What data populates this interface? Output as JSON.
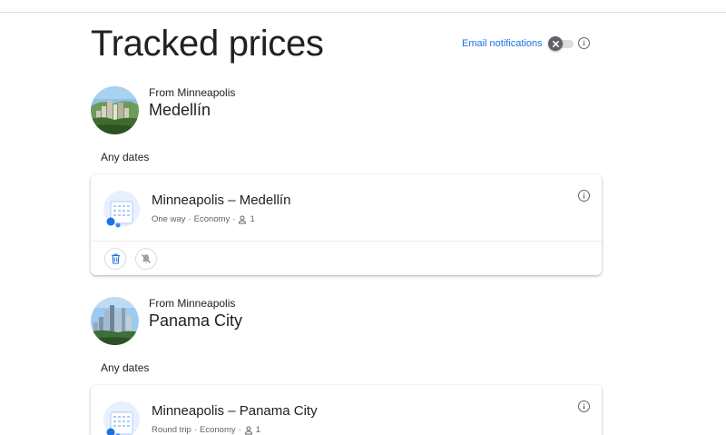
{
  "header": {
    "title": "Tracked prices",
    "email_notifications_label": "Email notifications",
    "email_notifications_enabled": false
  },
  "trips": [
    {
      "from_label": "From Minneapolis",
      "destination": "Medellín",
      "dates_label": "Any dates",
      "route": "Minneapolis – Medellín",
      "trip_type": "One way",
      "cabin": "Economy",
      "passengers": "1"
    },
    {
      "from_label": "From Minneapolis",
      "destination": "Panama City",
      "dates_label": "Any dates",
      "route": "Minneapolis – Panama City",
      "trip_type": "Round trip",
      "cabin": "Economy",
      "passengers": "1"
    }
  ],
  "meta_separator": "·",
  "colors": {
    "accent": "#1a73e8",
    "text_primary": "#202124",
    "text_secondary": "#5f6368",
    "divider": "#dadce0"
  },
  "icons": {
    "info": "info-icon",
    "toggle_off": "close-icon",
    "delete": "trash-icon",
    "alert": "bell-off-icon",
    "passenger": "person-icon",
    "calendar": "calendar-illustration-icon"
  }
}
